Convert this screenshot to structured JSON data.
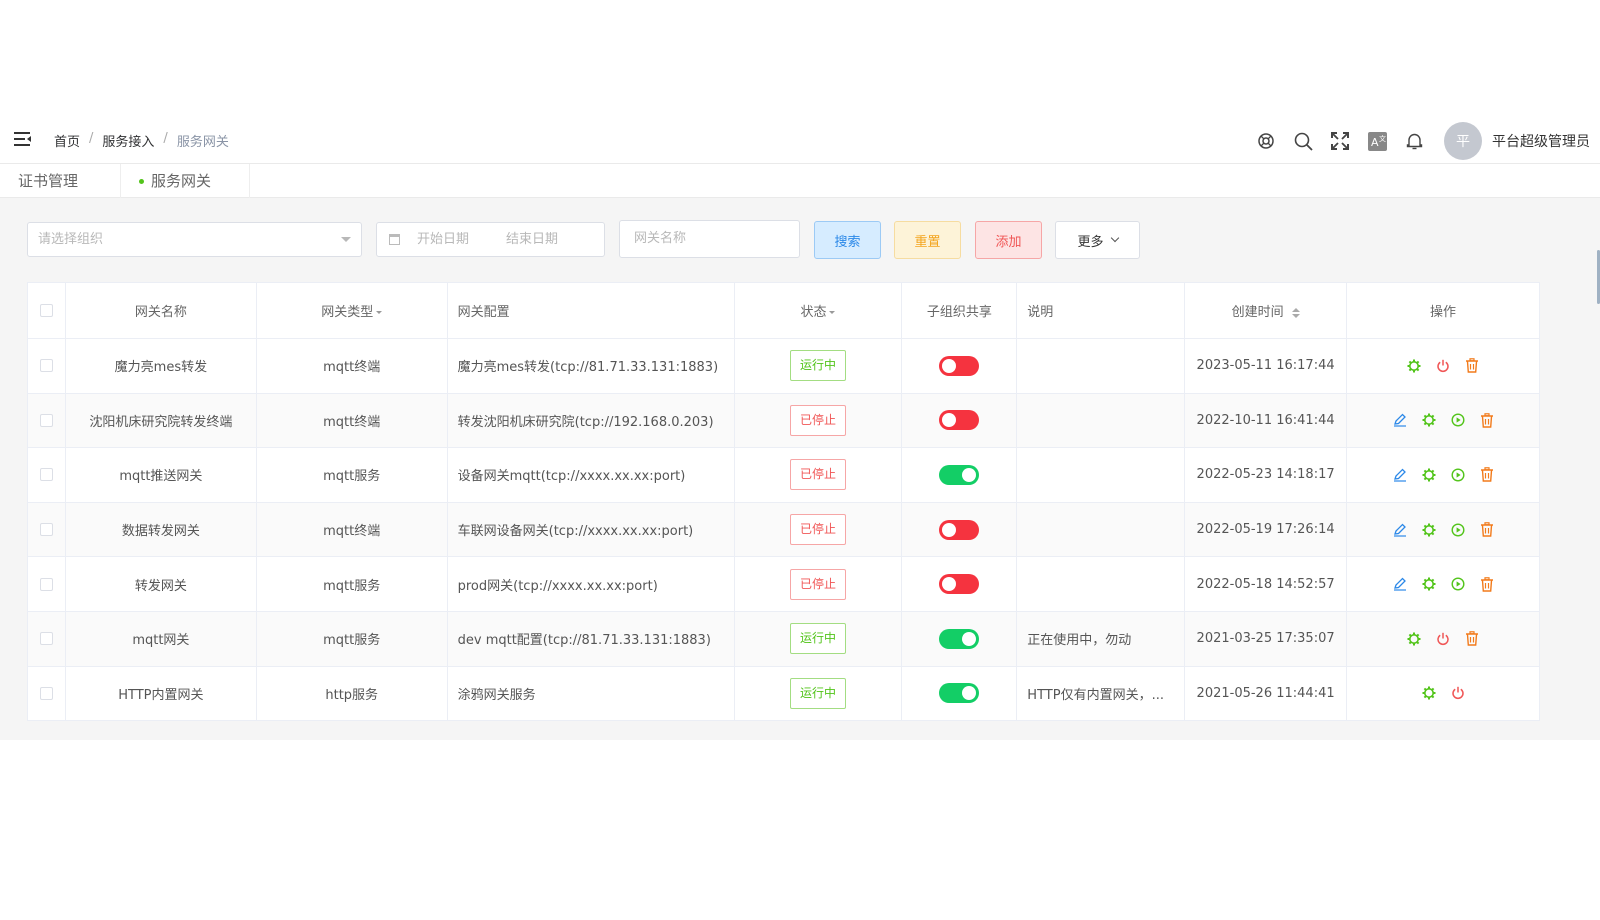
{
  "header": {
    "breadcrumb": [
      "首页",
      "服务接入",
      "服务网关"
    ],
    "avatar_text": "平",
    "username": "平台超级管理员"
  },
  "tags": [
    {
      "label": "证书管理"
    },
    {
      "label": "服务网关"
    }
  ],
  "filter": {
    "org_placeholder": "请选择组织",
    "start_date_placeholder": "开始日期",
    "end_date_placeholder": "结束日期",
    "name_placeholder": "网关名称",
    "search_label": "搜索",
    "reset_label": "重置",
    "add_label": "添加",
    "more_label": "更多"
  },
  "table": {
    "headers": {
      "name": "网关名称",
      "type": "网关类型",
      "config": "网关配置",
      "status": "状态",
      "share": "子组织共享",
      "desc": "说明",
      "created": "创建时间",
      "ops": "操作"
    },
    "rows": [
      {
        "name": "魔力亮mes转发",
        "type": "mqtt终端",
        "config": "魔力亮mes转发(tcp://81.71.33.131:1883)",
        "status": "运行中",
        "running": true,
        "share": false,
        "desc": "",
        "created": "2023-05-11 16:17:44",
        "ops": [
          "settings",
          "power",
          "delete"
        ]
      },
      {
        "name": "沈阳机床研究院转发终端",
        "type": "mqtt终端",
        "config": "转发沈阳机床研究院(tcp://192.168.0.203)",
        "status": "已停止",
        "running": false,
        "share": false,
        "desc": "",
        "created": "2022-10-11 16:41:44",
        "ops": [
          "edit",
          "settings",
          "play",
          "delete"
        ]
      },
      {
        "name": "mqtt推送网关",
        "type": "mqtt服务",
        "config": "设备网关mqtt(tcp://xxxx.xx.xx:port)",
        "status": "已停止",
        "running": false,
        "share": true,
        "desc": "",
        "created": "2022-05-23 14:18:17",
        "ops": [
          "edit",
          "settings",
          "play",
          "delete"
        ]
      },
      {
        "name": "数据转发网关",
        "type": "mqtt终端",
        "config": "车联网设备网关(tcp://xxxx.xx.xx:port)",
        "status": "已停止",
        "running": false,
        "share": false,
        "desc": "",
        "created": "2022-05-19 17:26:14",
        "ops": [
          "edit",
          "settings",
          "play",
          "delete"
        ]
      },
      {
        "name": "转发网关",
        "type": "mqtt服务",
        "config": "prod网关(tcp://xxxx.xx.xx:port)",
        "status": "已停止",
        "running": false,
        "share": false,
        "desc": "",
        "created": "2022-05-18 14:52:57",
        "ops": [
          "edit",
          "settings",
          "play",
          "delete"
        ]
      },
      {
        "name": "mqtt网关",
        "type": "mqtt服务",
        "config": "dev mqtt配置(tcp://81.71.33.131:1883)",
        "status": "运行中",
        "running": true,
        "share": true,
        "desc": "正在使用中，勿动",
        "created": "2021-03-25 17:35:07",
        "ops": [
          "settings",
          "power",
          "delete"
        ]
      },
      {
        "name": "HTTP内置网关",
        "type": "http服务",
        "config": "涂鸦网关服务",
        "status": "运行中",
        "running": true,
        "share": true,
        "desc": "HTTP仅有内置网关，...",
        "created": "2021-05-26 11:44:41",
        "ops": [
          "settings",
          "power"
        ]
      }
    ]
  },
  "colors": {
    "green": "#52c41a",
    "red": "#f05656",
    "blue": "#2b88e8",
    "orange": "#f3a51f",
    "switch_on": "#13ce66",
    "switch_off": "#f5333f"
  },
  "icons": {
    "edit": "pencil-icon",
    "settings": "gear-icon",
    "power": "power-icon",
    "play": "play-circle-icon",
    "delete": "trash-icon"
  }
}
